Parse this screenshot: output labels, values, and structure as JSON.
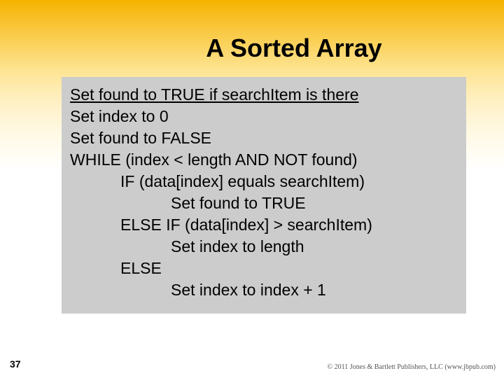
{
  "title": "A Sorted Array",
  "page_number": "37",
  "copyright": "© 2011 Jones & Bartlett Publishers, LLC (www.jbpub.com)",
  "code": {
    "lead": "Set found to TRUE if searchItem is there",
    "l1": "Set index to 0",
    "l2": "Set found to FALSE",
    "l3": "WHILE (index < length AND NOT found)",
    "l4": "IF (data[index] equals searchItem)",
    "l5": "Set found to TRUE",
    "l6": "ELSE IF (data[index] > searchItem)",
    "l7": "Set index to length",
    "l8": "ELSE",
    "l9": "Set index to index + 1"
  }
}
